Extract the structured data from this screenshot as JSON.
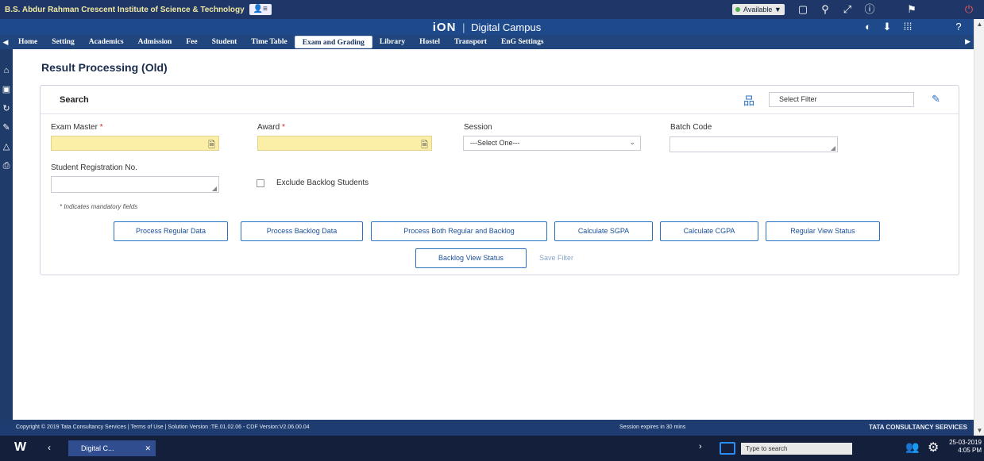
{
  "topbar": {
    "institution": "B.S. Abdur Rahman Crescent Institute of Science & Technology",
    "status": "Available ▼"
  },
  "titlebar": {
    "brand_logo": "iON",
    "brand_sep": "|",
    "brand_name": "Digital Campus"
  },
  "nav": {
    "items": [
      "Home",
      "Setting",
      "Academics",
      "Admission",
      "Fee",
      "Student",
      "Time Table",
      "Exam and Grading",
      "Library",
      "Hostel",
      "Transport",
      "EnG Settings"
    ],
    "active": "Exam and Grading"
  },
  "page": {
    "title": "Result Processing (Old)"
  },
  "search": {
    "label": "Search",
    "filter_placeholder": "Select Filter"
  },
  "form": {
    "exam_master": {
      "label": "Exam Master",
      "required_mark": "*",
      "value": ""
    },
    "award": {
      "label": "Award",
      "required_mark": "*",
      "value": ""
    },
    "session": {
      "label": "Session",
      "selected": "---Select One---"
    },
    "batch_code": {
      "label": "Batch Code",
      "value": ""
    },
    "student_reg": {
      "label": "Student Registration No.",
      "value": ""
    },
    "exclude_backlog": {
      "label": "Exclude Backlog Students",
      "checked": false
    },
    "mandatory_note": "* Indicates mandatory fields"
  },
  "buttons": {
    "process_regular": "Process Regular Data",
    "process_backlog": "Process Backlog Data",
    "process_both": "Process Both Regular and Backlog",
    "calc_sgpa": "Calculate SGPA",
    "calc_cgpa": "Calculate CGPA",
    "regular_view": "Regular View Status",
    "backlog_view": "Backlog View Status",
    "save_filter": "Save Filter"
  },
  "footer": {
    "copyright": "Copyright © 2019 Tata Consultancy Services | Terms of Use | Solution Version :TE.01.02.06 - CDF Version:V2.06.00.04",
    "session": "Session expires in 30 mins",
    "company": "TATA CONSULTANCY SERVICES"
  },
  "taskbar": {
    "app_label": "Digital C...",
    "search_placeholder": "Type to search",
    "date": "25-03-2019",
    "time": "4:05 PM"
  },
  "colors": {
    "nav_bg": "#20467d",
    "required_field": "#fbeea6",
    "button_border": "#2a73c0"
  }
}
